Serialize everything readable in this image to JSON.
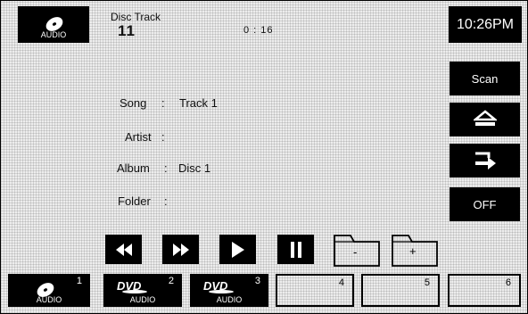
{
  "source": {
    "icon": "audio-disc-icon",
    "label": "AUDIO"
  },
  "header": {
    "label": "Disc Track",
    "track": "11",
    "time": "0 : 16"
  },
  "clock": "10:26PM",
  "side_menu": {
    "scan": "Scan",
    "eject_icon": "eject-icon",
    "return_icon": "return-arrow-icon",
    "off": "OFF"
  },
  "info": {
    "song_label": "Song",
    "song_value": "Track 1",
    "artist_label": "Artist",
    "artist_value": "",
    "album_label": "Album",
    "album_value": "Disc 1",
    "folder_label": "Folder",
    "folder_value": "",
    "separator": ":"
  },
  "controls": {
    "rewind_icon": "rewind-icon",
    "fast_forward_icon": "fast-forward-icon",
    "play_icon": "play-icon",
    "pause_icon": "pause-icon",
    "folder_down_sign": "-",
    "folder_up_sign": "+"
  },
  "presets": [
    {
      "number": "1",
      "label": "AUDIO",
      "icon": "audio-disc-icon",
      "active": true
    },
    {
      "number": "2",
      "label": "AUDIO",
      "icon": "dvd-logo-icon",
      "active": true
    },
    {
      "number": "3",
      "label": "AUDIO",
      "icon": "dvd-logo-icon",
      "active": true
    },
    {
      "number": "4",
      "label": "",
      "active": false
    },
    {
      "number": "5",
      "label": "",
      "active": false
    },
    {
      "number": "6",
      "label": "",
      "active": false
    }
  ]
}
